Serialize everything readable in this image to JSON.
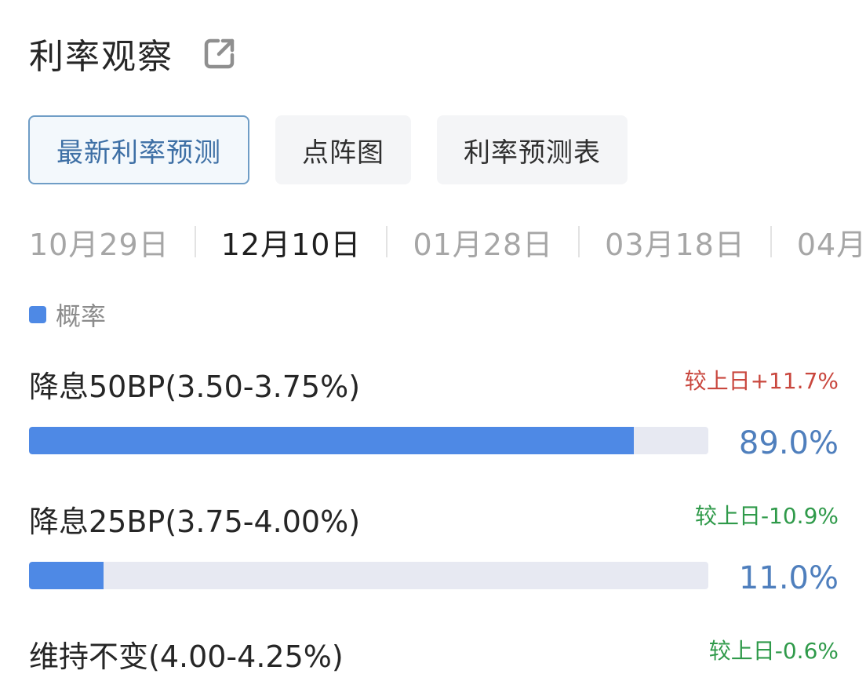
{
  "header": {
    "title": "利率观察",
    "external_icon": "external-link-icon"
  },
  "tabs": [
    {
      "label": "最新利率预测",
      "active": true
    },
    {
      "label": "点阵图",
      "active": false
    },
    {
      "label": "利率预测表",
      "active": false
    }
  ],
  "dates": [
    {
      "label": "10月29日",
      "active": false
    },
    {
      "label": "12月10日",
      "active": true
    },
    {
      "label": "01月28日",
      "active": false
    },
    {
      "label": "03月18日",
      "active": false
    },
    {
      "label": "04月2",
      "active": false
    }
  ],
  "legend": {
    "label": "概率",
    "color": "#4e89e5"
  },
  "rows": [
    {
      "label": "降息50BP(3.50-3.75%)",
      "change": "较上日+11.7%",
      "change_color": "#c9473e",
      "percent_text": "89.0%",
      "fraction": 0.89
    },
    {
      "label": "降息25BP(3.75-4.00%)",
      "change": "较上日-10.9%",
      "change_color": "#2f9a4a",
      "percent_text": "11.0%",
      "fraction": 0.11
    },
    {
      "label": "维持不变(4.00-4.25%)",
      "change": "较上日-0.6%",
      "change_color": "#2f9a4a",
      "percent_text": "",
      "fraction": null
    }
  ],
  "colors": {
    "accent": "#4e89e5",
    "tab_active_border": "#6f9dc6",
    "tab_active_text": "#3d6fa5",
    "percent_text": "#4f7fbd",
    "bar_track": "#e7e9f2"
  }
}
